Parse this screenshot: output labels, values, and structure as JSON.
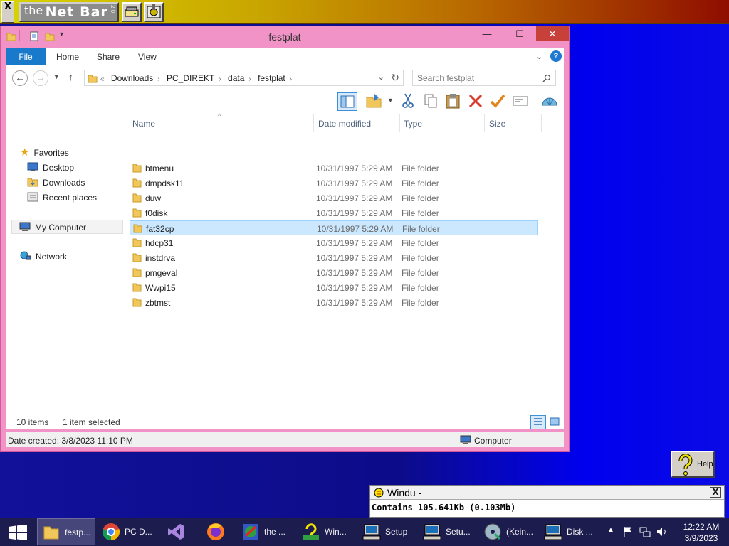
{
  "netbar": {
    "close_label": "X",
    "logo_the": "the",
    "logo_name": "Net Bar",
    "logo_version": "2.0"
  },
  "window": {
    "title": "festplat",
    "minimize_label": "—",
    "maximize_label": "☐",
    "close_label": "✕"
  },
  "ribbon": {
    "tabs": [
      "File",
      "Home",
      "Share",
      "View"
    ]
  },
  "address": {
    "prefix": "«",
    "crumbs": [
      "Downloads",
      "PC_DIREKT",
      "data",
      "festplat"
    ],
    "search_placeholder": "Search festplat"
  },
  "navpane": {
    "favorites": "Favorites",
    "items": [
      "Desktop",
      "Downloads",
      "Recent places"
    ],
    "computer": "My Computer",
    "network": "Network"
  },
  "columns": {
    "name": "Name",
    "date": "Date modified",
    "type": "Type",
    "size": "Size"
  },
  "files": [
    {
      "name": "btmenu",
      "date": "10/31/1997 5:29 AM",
      "type": "File folder",
      "selected": false
    },
    {
      "name": "dmpdsk11",
      "date": "10/31/1997 5:29 AM",
      "type": "File folder",
      "selected": false
    },
    {
      "name": "duw",
      "date": "10/31/1997 5:29 AM",
      "type": "File folder",
      "selected": false
    },
    {
      "name": "f0disk",
      "date": "10/31/1997 5:29 AM",
      "type": "File folder",
      "selected": false
    },
    {
      "name": "fat32cp",
      "date": "10/31/1997 5:29 AM",
      "type": "File folder",
      "selected": true
    },
    {
      "name": "hdcp31",
      "date": "10/31/1997 5:29 AM",
      "type": "File folder",
      "selected": false
    },
    {
      "name": "instdrva",
      "date": "10/31/1997 5:29 AM",
      "type": "File folder",
      "selected": false
    },
    {
      "name": "pmgeval",
      "date": "10/31/1997 5:29 AM",
      "type": "File folder",
      "selected": false
    },
    {
      "name": "Wwpi15",
      "date": "10/31/1997 5:29 AM",
      "type": "File folder",
      "selected": false
    },
    {
      "name": "zbtmst",
      "date": "10/31/1997 5:29 AM",
      "type": "File folder",
      "selected": false
    }
  ],
  "itemsbar": {
    "count": "10 items",
    "selected": "1 item selected"
  },
  "status": {
    "date_created": "Date created: 3/8/2023 11:10 PM",
    "location": "Computer"
  },
  "help": {
    "label": "Help"
  },
  "windu": {
    "title": "Windu -",
    "message": "Contains 105.641Kb (0.103Mb)",
    "close_label": "X"
  },
  "taskbar": {
    "items": [
      {
        "label": "festp...",
        "icon": "folder-icon"
      },
      {
        "label": "PC D...",
        "icon": "chrome-icon"
      },
      {
        "label": "",
        "icon": "visual-studio-icon"
      },
      {
        "label": "",
        "icon": "firefox-icon"
      },
      {
        "label": "the ...",
        "icon": "netbar-icon"
      },
      {
        "label": "Win...",
        "icon": "help-icon"
      },
      {
        "label": "Setup",
        "icon": "computer-icon"
      },
      {
        "label": "Setu...",
        "icon": "computer-icon"
      },
      {
        "label": "(Kein...",
        "icon": "cd-icon"
      },
      {
        "label": "Disk ...",
        "icon": "computer-icon"
      }
    ],
    "time": "12:22 AM",
    "date": "3/9/2023"
  },
  "colors": {
    "window_border": "#f193c7",
    "accent": "#1979ca",
    "selection": "#cce8ff",
    "taskbar": "#1c1c4e"
  }
}
